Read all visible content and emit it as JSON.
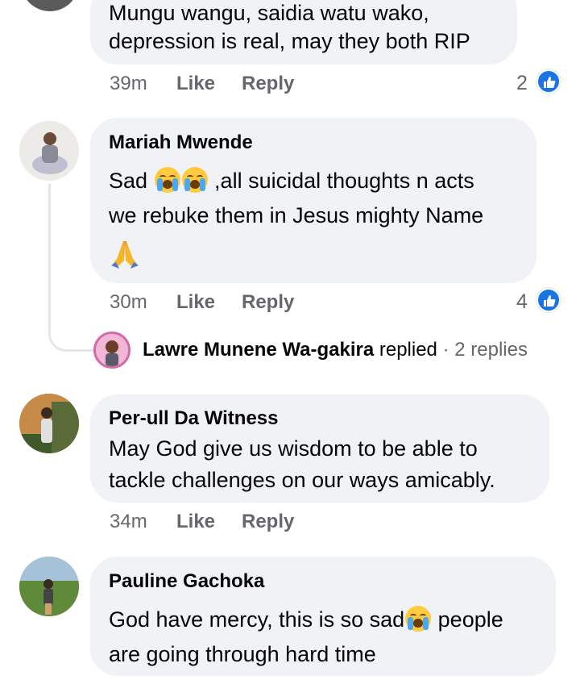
{
  "comments": [
    {
      "lines": [
        "Mungu wangu, saidia watu wako,",
        "depression is real, may they both RIP"
      ],
      "time": "39m",
      "like": "Like",
      "reply": "Reply",
      "reactions": "2"
    },
    {
      "author": "Mariah Mwende",
      "line1_start": "Sad ",
      "line1_end": " ,all suicidal thoughts n acts",
      "line2": "we rebuke them in Jesus mighty Name",
      "emoji": [
        "crying-face",
        "crying-face",
        "folded-hands"
      ],
      "time": "30m",
      "like": "Like",
      "reply": "Reply",
      "reactions": "4",
      "replies_preview": {
        "author": "Lawre Munene Wa-gakira",
        "action": "replied",
        "separator": "·",
        "count": "2 replies"
      }
    },
    {
      "author": "Per-ull Da Witness",
      "lines": [
        "May God give us wisdom to be able to",
        "tackle challenges on our ways amicably."
      ],
      "time": "34m",
      "like": "Like",
      "reply": "Reply"
    },
    {
      "author": "Pauline Gachoka",
      "line1_start": "God have mercy, this is so sad",
      "line1_end": " people",
      "line2": "are going through hard time",
      "emoji": [
        "crying-face"
      ]
    }
  ],
  "colors": {
    "bubble": "#f0f2f5",
    "meta": "#65676b",
    "like_blue": "#1b74e4",
    "text": "#050505"
  }
}
